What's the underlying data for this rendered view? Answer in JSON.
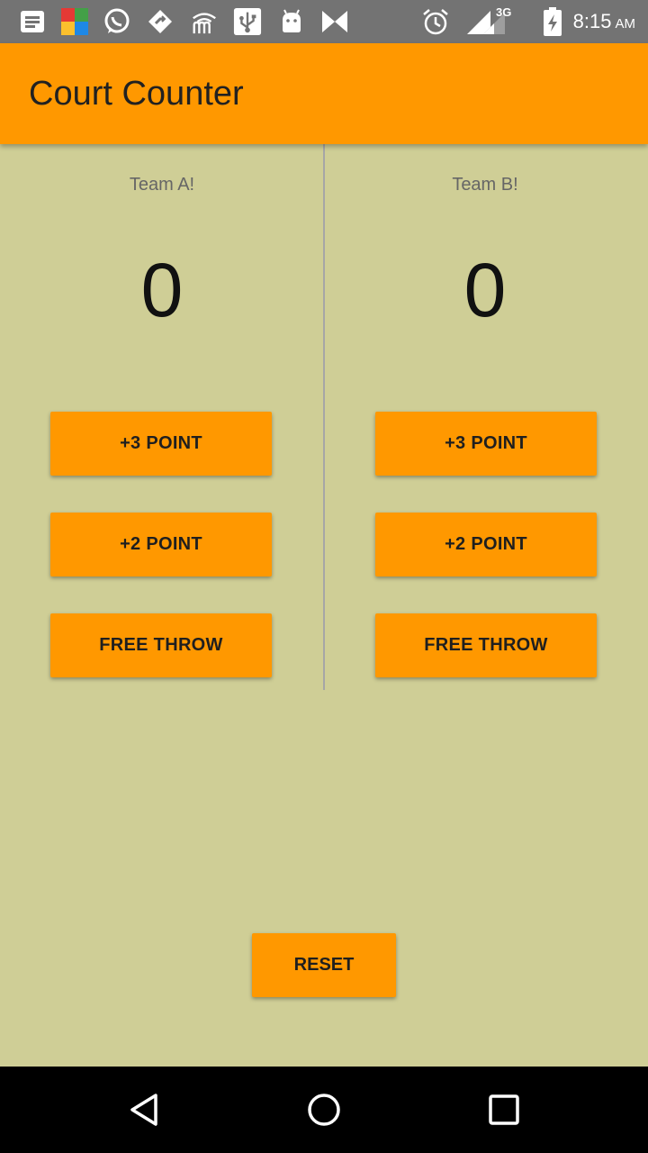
{
  "status_bar": {
    "time": "8:15",
    "ampm": "AM",
    "network_label": "3G",
    "icons": [
      "notes-icon",
      "avg-icon",
      "whatsapp-icon",
      "share-icon",
      "wifi-calling-icon",
      "usb-icon",
      "android-icon",
      "bow-icon",
      "alarm-icon",
      "signal-icon",
      "battery-charging-icon"
    ]
  },
  "app_bar": {
    "title": "Court Counter"
  },
  "team_a": {
    "name": "Team A!",
    "score": "0",
    "buttons": {
      "three": "+3 POINT",
      "two": "+2 POINT",
      "free_throw": "FREE THROW"
    }
  },
  "team_b": {
    "name": "Team B!",
    "score": "0",
    "buttons": {
      "three": "+3 POINT",
      "two": "+2 POINT",
      "free_throw": "FREE THROW"
    }
  },
  "reset": {
    "label": "RESET"
  },
  "nav_bar": {
    "icons": [
      "back-icon",
      "home-icon",
      "recents-icon"
    ]
  },
  "colors": {
    "accent": "#ff9800",
    "background": "#cfce96",
    "status_bar": "#737373",
    "nav_bar": "#000000"
  }
}
